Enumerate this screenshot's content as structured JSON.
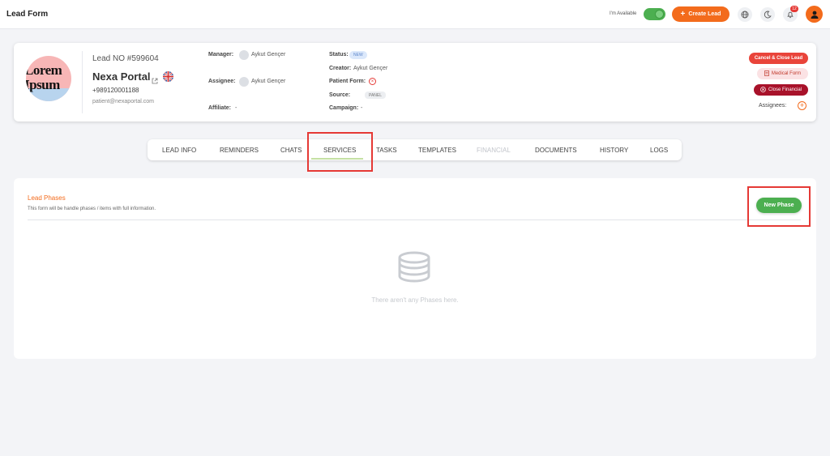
{
  "app": {
    "title": "Lead Form"
  },
  "topbar": {
    "availability_label": "I'm Available",
    "availability_on": true,
    "create_lead_label": "Create Lead",
    "notification_count": "12",
    "icons": [
      "globe-icon",
      "moon-icon",
      "bell-icon",
      "user-icon"
    ]
  },
  "lead": {
    "logo_text_line1": "Lorem",
    "logo_text_line2": "Ipsum",
    "number": "Lead NO #599604",
    "name": "Nexa Portal",
    "phone": "+989120001188",
    "email": "patient@nexaportal.com",
    "manager_label": "Manager:",
    "manager": "Aykut Gençer",
    "assignee_label": "Assignee:",
    "assignee": "Aykut Gençer",
    "affiliate_label": "Affiliate:",
    "affiliate": "-",
    "status_label": "Status:",
    "status": "NEW",
    "creator_label": "Creator:",
    "creator": "Aykut Gençer",
    "patient_form_label": "Patient Form:",
    "source_label": "Source:",
    "source": "PANEL",
    "campaign_label": "Campaign:",
    "campaign": "-",
    "actions": {
      "cancel_close": "Cancel & Close Lead",
      "medical_form": "Medical Form",
      "close_financial": "Close Financial"
    },
    "assignees_label": "Assignees:"
  },
  "tabs": [
    {
      "label": "LEAD INFO"
    },
    {
      "label": "REMINDERS"
    },
    {
      "label": "CHATS"
    },
    {
      "label": "SERVICES",
      "active": true
    },
    {
      "label": "TASKS"
    },
    {
      "label": "TEMPLATES"
    },
    {
      "label": "FINANCIAL",
      "disabled": true
    },
    {
      "label": "DOCUMENTS"
    },
    {
      "label": "HISTORY"
    },
    {
      "label": "LOGS"
    }
  ],
  "phases": {
    "title": "Lead Phases",
    "description": "This form will be handle phases / items with full information.",
    "new_button": "New Phase",
    "empty_text": "There aren't any Phases here."
  },
  "colors": {
    "accent": "#f36b1c",
    "success": "#4caf50",
    "danger": "#e9443a",
    "dark_red": "#a8122a",
    "highlight": "#e53935"
  }
}
